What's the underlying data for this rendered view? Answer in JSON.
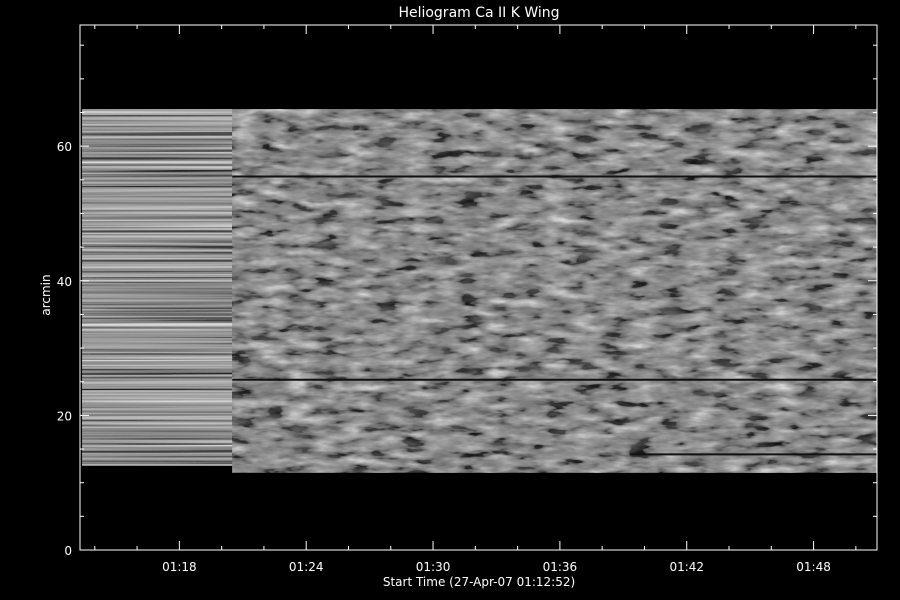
{
  "chart_data": {
    "type": "heatmap",
    "title": "Heliogram Ca II K Wing",
    "xlabel": "Start Time (27-Apr-07 01:12:52)",
    "ylabel": "arcmin",
    "x_unit": "minutes",
    "xlim": [
      73.3,
      111.0
    ],
    "ylim": [
      0,
      78
    ],
    "x_ticks": [
      {
        "value": 78,
        "label": "01:18"
      },
      {
        "value": 84,
        "label": "01:24"
      },
      {
        "value": 90,
        "label": "01:30"
      },
      {
        "value": 96,
        "label": "01:36"
      },
      {
        "value": 102,
        "label": "01:42"
      },
      {
        "value": 108,
        "label": "01:48"
      }
    ],
    "y_ticks": [
      {
        "value": 0,
        "label": "0"
      },
      {
        "value": 20,
        "label": "20"
      },
      {
        "value": 40,
        "label": "40"
      },
      {
        "value": 60,
        "label": "60"
      }
    ],
    "colormap": "grayscale",
    "colors": {
      "background": "#000000",
      "axes": "#ffffff",
      "text": "#ffffff"
    },
    "regions": [
      {
        "name": "striped",
        "x": [
          73.4,
          80.5
        ],
        "y": [
          12.5,
          65.5
        ]
      },
      {
        "name": "textured",
        "x": [
          80.5,
          111.0
        ],
        "y": [
          11.5,
          65.5
        ]
      }
    ],
    "dark_lines": [
      {
        "y": 55.5,
        "x": [
          80.5,
          111.0
        ]
      },
      {
        "y": 25.3,
        "x": [
          80.5,
          111.0
        ]
      },
      {
        "y": 14.2,
        "x": [
          99.3,
          111.0
        ]
      }
    ],
    "grid": false
  }
}
